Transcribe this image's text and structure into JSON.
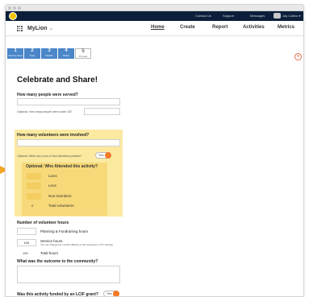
{
  "topbar": {
    "links": [
      "Contact Us",
      "Support",
      "Messages",
      "Jay Collins ▾"
    ]
  },
  "navbar": {
    "brand": "MyLion",
    "brand_caret": "⌄",
    "items": [
      "Home",
      "Create",
      "Report",
      "Activities",
      "Metrics"
    ]
  },
  "steps": [
    {
      "num": "1",
      "label": "Service Area"
    },
    {
      "num": "2",
      "label": "Type"
    },
    {
      "num": "3",
      "label": "Details"
    },
    {
      "num": "4",
      "label": "Share"
    },
    {
      "num": "5",
      "label": "Preview"
    }
  ],
  "close_glyph": "×",
  "form": {
    "title": "Celebrate and Share!",
    "q_served": "How many people were served?",
    "q_under18": "Optional: How many people were under 18?",
    "q_volunteers": "How many volunteers were involved?",
    "q_leos": "Optional: Were any Leos or Non-Members present?",
    "toggle_yes": "Yes",
    "attended_title": "Optional: Who Attended this activity?",
    "attended_rows": [
      "Lions",
      "Leos",
      "Non-members"
    ],
    "attended_total_value": "0",
    "attended_total_label": "Total volunteers",
    "hours_title": "Number of volunteer hours",
    "hours_planning": "Planning & Fundraising hours",
    "hours_service_value": "100",
    "hours_service_label": "Service hours",
    "hours_service_note": "You can change the number (Based on 20 volunteers x 5 hr activity)",
    "hours_total_value": "100",
    "hours_total_label": "Total hours",
    "q_outcome": "What was the outcome to the community?",
    "q_grant": "Was this activity funded by an LCIF grant?",
    "grant_toggle": "Yes"
  },
  "colors": {
    "step_fill": "#4a86c8",
    "step_next": "#b9b9b9",
    "highlight": "#fbe9a0",
    "toggle_on": "#f47b27",
    "arrow": "#f5a623",
    "topbar": "#0b1f3a"
  }
}
